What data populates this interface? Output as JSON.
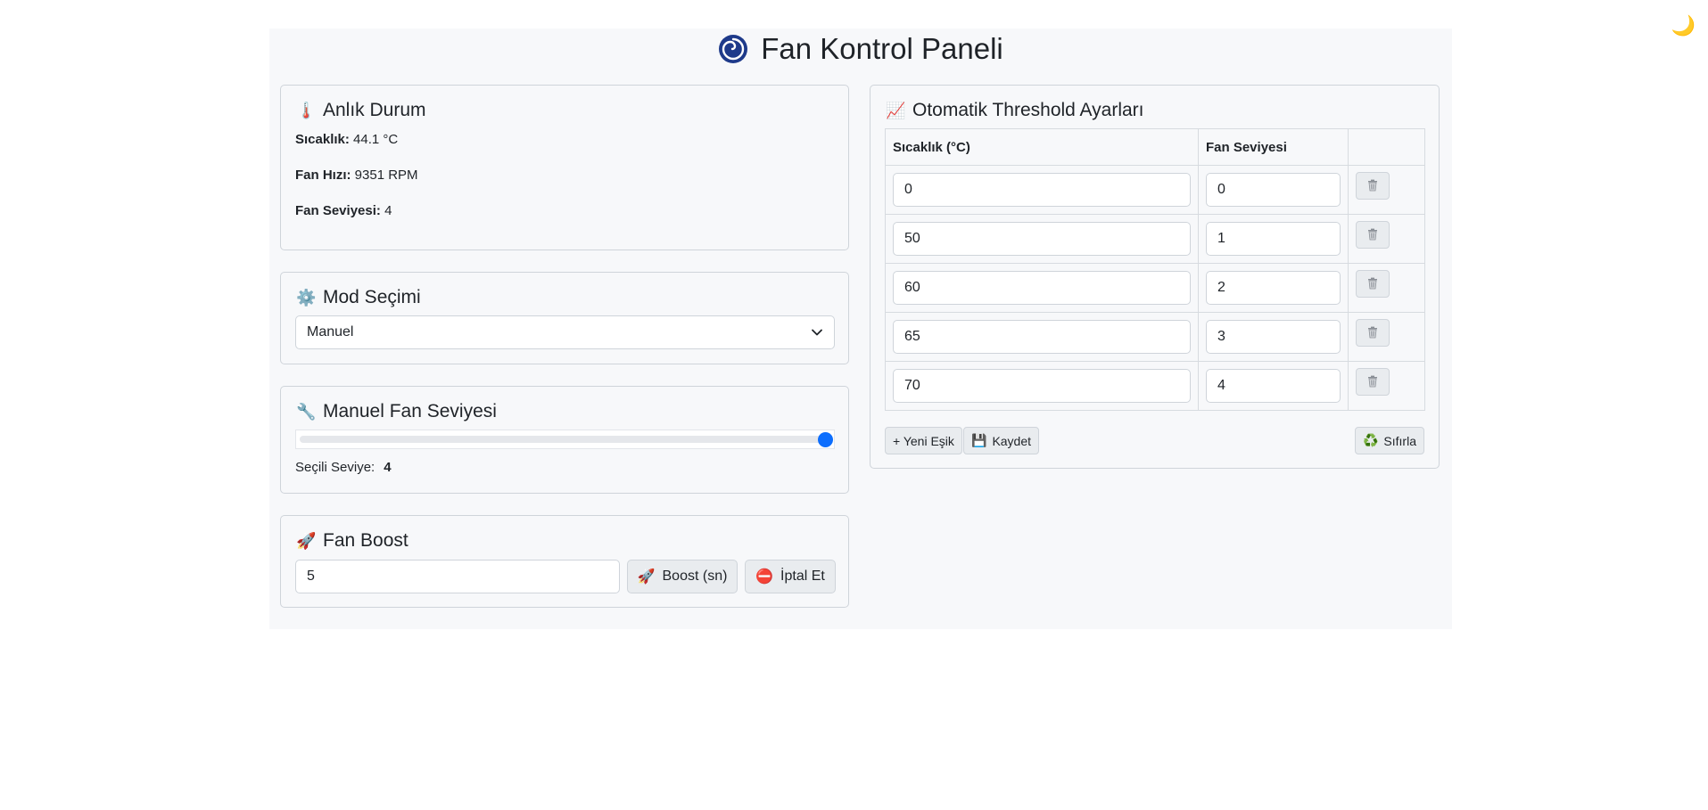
{
  "theme_toggle": "🌙",
  "header": {
    "title": "Fan Kontrol Paneli",
    "icon": "🌀"
  },
  "status": {
    "title": "Anlık Durum",
    "icon": "🌡️",
    "temp_label": "Sıcaklık:",
    "temp_value": "44.1 °C",
    "speed_label": "Fan Hızı:",
    "speed_value": "9351 RPM",
    "level_label": "Fan Seviyesi:",
    "level_value": "4"
  },
  "mode": {
    "title": "Mod Seçimi",
    "icon": "⚙️",
    "selected": "Manuel"
  },
  "manual": {
    "title": "Manuel Fan Seviyesi",
    "icon": "🔧",
    "slider_value_fraction": 1.0,
    "selected_label": "Seçili Seviye:",
    "selected_value": "4"
  },
  "boost": {
    "title": "Fan Boost",
    "icon": "🚀",
    "input_value": "5",
    "boost_label": "Boost (sn)",
    "boost_icon": "🚀",
    "cancel_label": "İptal Et",
    "cancel_icon": "⛔"
  },
  "threshold": {
    "title": "Otomatik Threshold Ayarları",
    "icon": "📈",
    "col_temp": "Sıcaklık (°C)",
    "col_level": "Fan Seviyesi",
    "rows": [
      {
        "temp": "0",
        "level": "0"
      },
      {
        "temp": "50",
        "level": "1"
      },
      {
        "temp": "60",
        "level": "2"
      },
      {
        "temp": "65",
        "level": "3"
      },
      {
        "temp": "70",
        "level": "4"
      }
    ],
    "add_label": "+ Yeni Eşik",
    "save_label": "Kaydet",
    "save_icon": "💾",
    "reset_label": "Sıfırla",
    "reset_icon": "♻️"
  },
  "colors": {
    "accent": "#0d6efd",
    "swirl": "#1e3a8a",
    "page_bg": "#f7f8fa"
  }
}
